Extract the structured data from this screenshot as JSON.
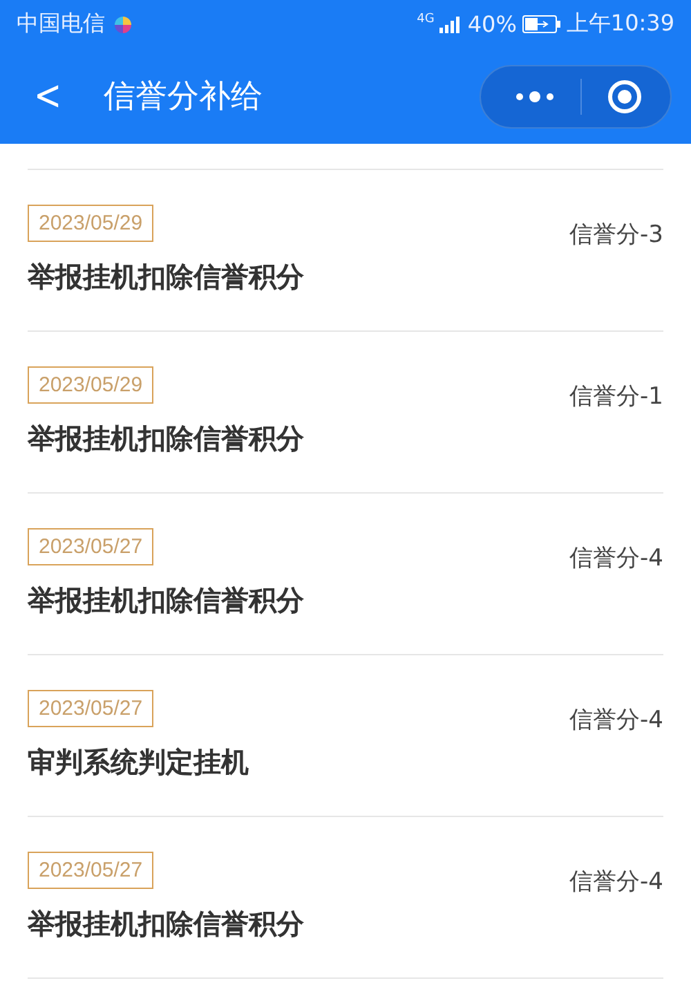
{
  "status_bar": {
    "carrier": "中国电信",
    "network": "4G",
    "battery": "40%",
    "time": "上午10:39"
  },
  "nav": {
    "back": "<",
    "title": "信誉分补给"
  },
  "records": [
    {
      "date": "2023/05/29",
      "title": "举报挂机扣除信誉积分",
      "change": "信誉分-3"
    },
    {
      "date": "2023/05/29",
      "title": "举报挂机扣除信誉积分",
      "change": "信誉分-1"
    },
    {
      "date": "2023/05/27",
      "title": "举报挂机扣除信誉积分",
      "change": "信誉分-4"
    },
    {
      "date": "2023/05/27",
      "title": "审判系统判定挂机",
      "change": "信誉分-4"
    },
    {
      "date": "2023/05/27",
      "title": "举报挂机扣除信誉积分",
      "change": "信誉分-4"
    }
  ]
}
